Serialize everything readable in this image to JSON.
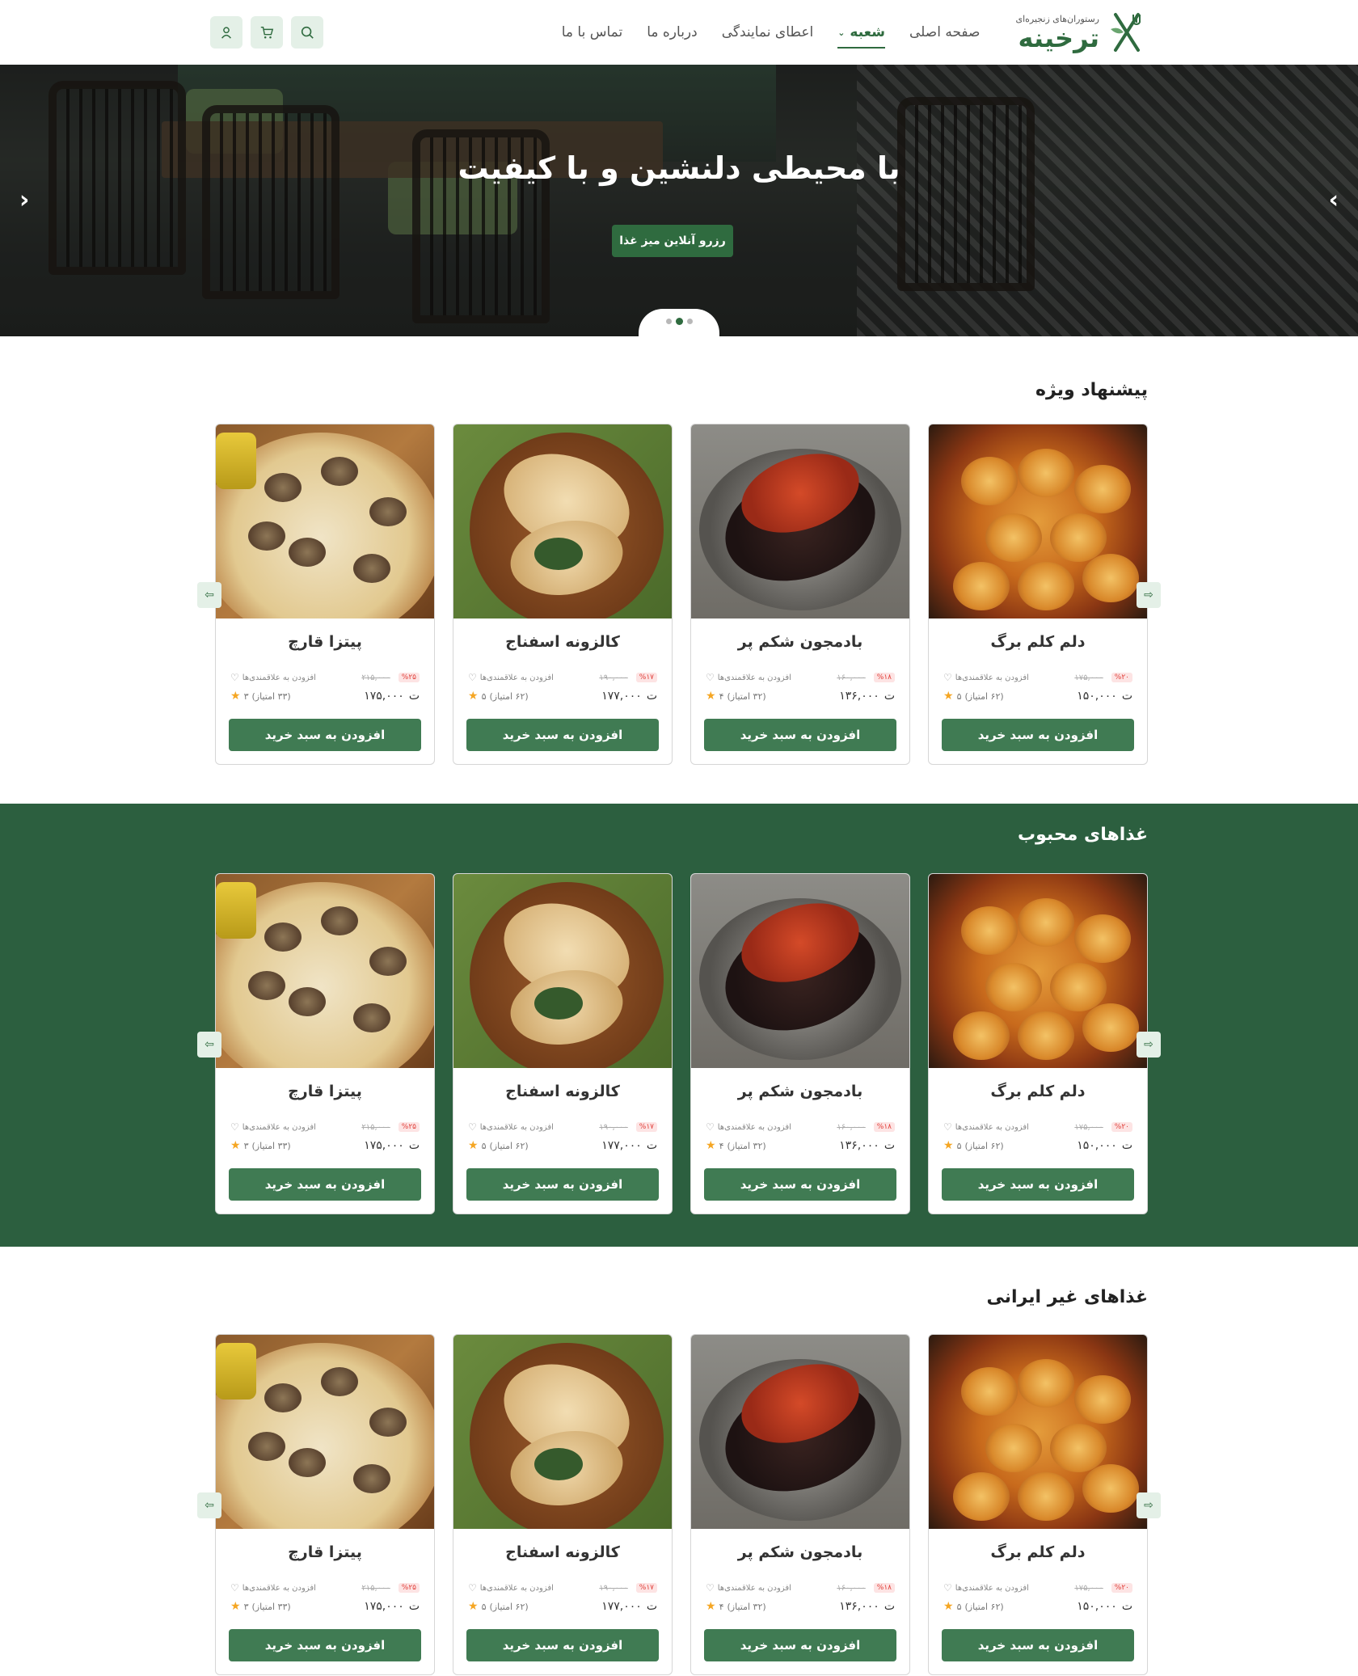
{
  "brand": {
    "sub": "رستوران‌های زنجیره‌ای",
    "name": "ترخینه",
    "accent": "#2f6b3f",
    "dark_green": "#2c5f3f"
  },
  "nav": {
    "items": [
      {
        "label": "صفحه اصلی"
      },
      {
        "label": "شعبه",
        "active": true,
        "has_dropdown": true
      },
      {
        "label": "اعطای نمایندگی"
      },
      {
        "label": "درباره ما"
      },
      {
        "label": "تماس با ما"
      }
    ],
    "tools": [
      "search-icon",
      "cart-icon",
      "user-icon"
    ]
  },
  "hero": {
    "title": "با محیطی دلنشین و با کیفیت",
    "button": "رزرو آنلاین میز غذا",
    "slide_count": 3,
    "active_slide": 2
  },
  "products": [
    {
      "name": "دلم کلم برگ",
      "wish": "افزودن به علاقمندی‌ها",
      "old_price": "۱۷۵,۰۰۰",
      "discount": "%۲۰",
      "rating": "۵",
      "votes": "(۶۲ امتیاز)",
      "price": "۱۵۰,۰۰۰",
      "currency": "ت",
      "button": "افزودن به سبد خرید",
      "image": "dolma"
    },
    {
      "name": "بادمجون شکم پر",
      "wish": "افزودن به علاقمندی‌ها",
      "old_price": "۱۶۰,۰۰۰",
      "discount": "%۱۸",
      "rating": "۴",
      "votes": "(۳۲ امتیاز)",
      "price": "۱۳۶,۰۰۰",
      "currency": "ت",
      "button": "افزودن به سبد خرید",
      "image": "eggplant"
    },
    {
      "name": "کالزونه اسفناج",
      "wish": "افزودن به علاقمندی‌ها",
      "old_price": "۱۹۰,۰۰۰",
      "discount": "%۱۷",
      "rating": "۵",
      "votes": "(۶۲ امتیاز)",
      "price": "۱۷۷,۰۰۰",
      "currency": "ت",
      "button": "افزودن به سبد خرید",
      "image": "calzone"
    },
    {
      "name": "پیتزا قارچ",
      "wish": "افزودن به علاقمندی‌ها",
      "old_price": "۲۱۵,۰۰۰",
      "discount": "%۲۵",
      "rating": "۳",
      "votes": "(۳۳ امتیاز)",
      "price": "۱۷۵,۰۰۰",
      "currency": "ت",
      "button": "افزودن به سبد خرید",
      "image": "pizza"
    }
  ],
  "sections": [
    {
      "title": "پیشنهاد ویژه"
    },
    {
      "title": "غذاهای محبوب"
    },
    {
      "title": "غذاهای غیر ایرانی"
    }
  ]
}
